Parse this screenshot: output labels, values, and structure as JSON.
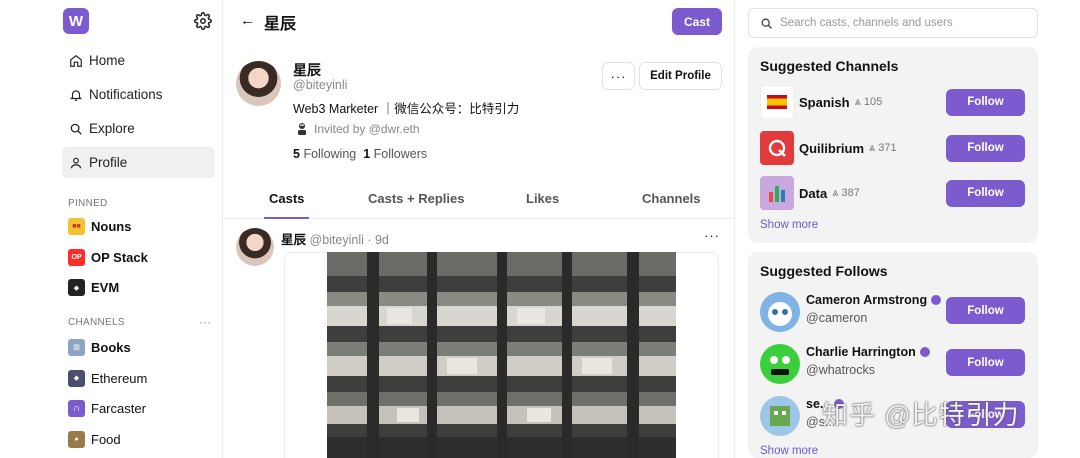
{
  "sidebar": {
    "logo": "W",
    "nav": [
      {
        "label": "Home",
        "icon": "home-icon"
      },
      {
        "label": "Notifications",
        "icon": "bell-icon"
      },
      {
        "label": "Explore",
        "icon": "search-icon"
      },
      {
        "label": "Profile",
        "icon": "user-icon",
        "active": true
      }
    ],
    "pinned_heading": "PINNED",
    "pinned": [
      {
        "label": "Nouns",
        "icon": "nouns-icon",
        "color": "#f2c230"
      },
      {
        "label": "OP Stack",
        "icon": "op-icon",
        "color": "#ff2a2a"
      },
      {
        "label": "EVM",
        "icon": "ethereum-icon",
        "color": "#222222"
      }
    ],
    "channels_heading": "CHANNELS",
    "channels_more": "···",
    "channels": [
      {
        "label": "Books",
        "icon": "books-icon",
        "color": "#8ca5c4"
      },
      {
        "label": "Ethereum",
        "icon": "ethereum-icon",
        "color": "#4a4f6b"
      },
      {
        "label": "Farcaster",
        "icon": "farcaster-icon",
        "color": "#7c5bcf"
      },
      {
        "label": "Food",
        "icon": "food-icon",
        "color": "#9b7a4a"
      }
    ]
  },
  "header": {
    "back_label": "←",
    "title": "星辰",
    "cast_label": "Cast"
  },
  "profile": {
    "name": "星辰",
    "handle": "@biteyinli",
    "bio": "Web3 Marketer ｜微信公众号：比特引力",
    "invited": "Invited by @dwr.eth",
    "following_count": "5",
    "following_label": "Following",
    "followers_count": "1",
    "followers_label": "Followers",
    "more_label": "···",
    "edit_label": "Edit Profile"
  },
  "tabs": [
    "Casts",
    "Casts + Replies",
    "Likes",
    "Channels"
  ],
  "post": {
    "name": "星辰",
    "meta": "@biteyinli · 9d",
    "more_label": "···"
  },
  "search": {
    "placeholder": "Search casts, channels and users"
  },
  "suggested_channels": {
    "title": "Suggested Channels",
    "items": [
      {
        "name": "Spanish",
        "count": "⩓ 105",
        "icon": "spain-flag-icon",
        "color": "#ffffff"
      },
      {
        "name": "Quilibrium",
        "count": "⩓ 371",
        "icon": "quilibrium-icon",
        "color": "#e23b3b"
      },
      {
        "name": "Data",
        "count": "⩓ 387",
        "icon": "bar-chart-icon",
        "color": "#c9a7df"
      }
    ],
    "follow_label": "Follow",
    "show_more": "Show more"
  },
  "suggested_follows": {
    "title": "Suggested Follows",
    "items": [
      {
        "name": "Cameron Armstrong",
        "handle": "@cameron",
        "verified": true,
        "color": "#7fb3e6"
      },
      {
        "name": "Charlie Harrington",
        "handle": "@whatrocks",
        "verified": true,
        "color": "#3ccf3c"
      },
      {
        "name": "se...",
        "handle": "@s...",
        "verified": true,
        "color": "#9ec6e8"
      }
    ],
    "follow_label": "Follow",
    "show_more": "Show more"
  },
  "watermark": "知乎 @比特引力",
  "colors": {
    "accent": "#7c5bcf"
  }
}
